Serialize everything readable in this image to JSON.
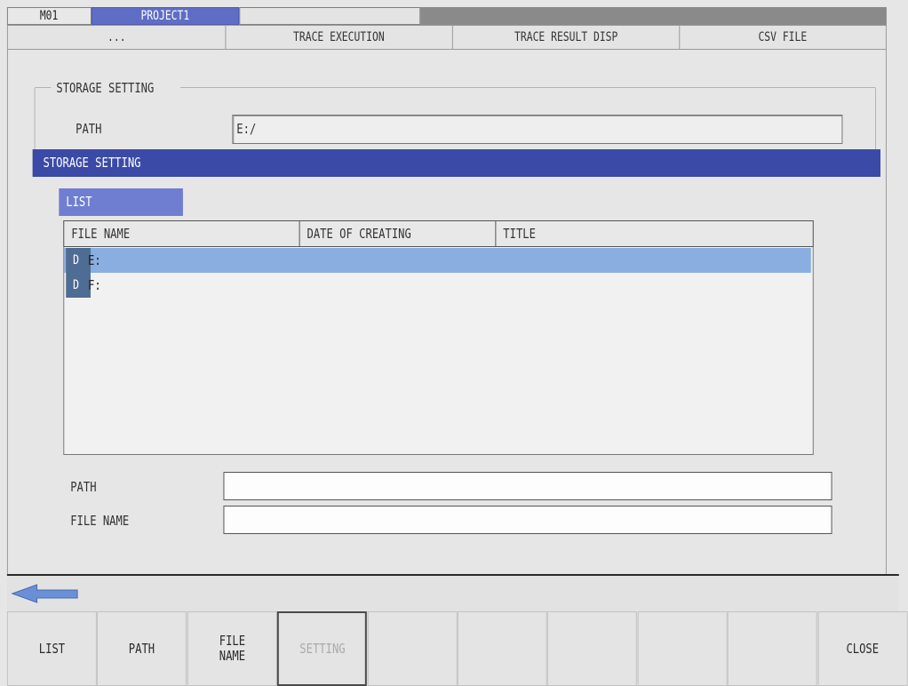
{
  "top_tabs": {
    "machine": "M01",
    "project": "PROJECT1"
  },
  "menu_tabs": [
    "...",
    "TRACE EXECUTION",
    "TRACE RESULT DISP",
    "CSV FILE"
  ],
  "background": {
    "group_title": "STORAGE SETTING",
    "path_label": "PATH",
    "path_value": "E:/"
  },
  "dialog": {
    "title": "STORAGE SETTING",
    "list_label": "LIST",
    "columns": [
      "FILE NAME",
      "DATE OF CREATING",
      "TITLE"
    ],
    "rows": [
      {
        "type": "D",
        "name": "E:",
        "selected": true
      },
      {
        "type": "D",
        "name": "F:",
        "selected": false
      }
    ],
    "path_label": "PATH",
    "path_value": "",
    "filename_label": "FILE NAME",
    "filename_value": ""
  },
  "function_keys": [
    "LIST",
    "PATH",
    "FILE\nNAME",
    "SETTING",
    "",
    "",
    "",
    "",
    "",
    "CLOSE"
  ],
  "disabled_key": "SETTING",
  "colors": {
    "title_bar": "#3b4aa6",
    "selected_row": "#8aaee0",
    "list_label": "#6f7ed0",
    "back_arrow": "#6a8fd6"
  }
}
